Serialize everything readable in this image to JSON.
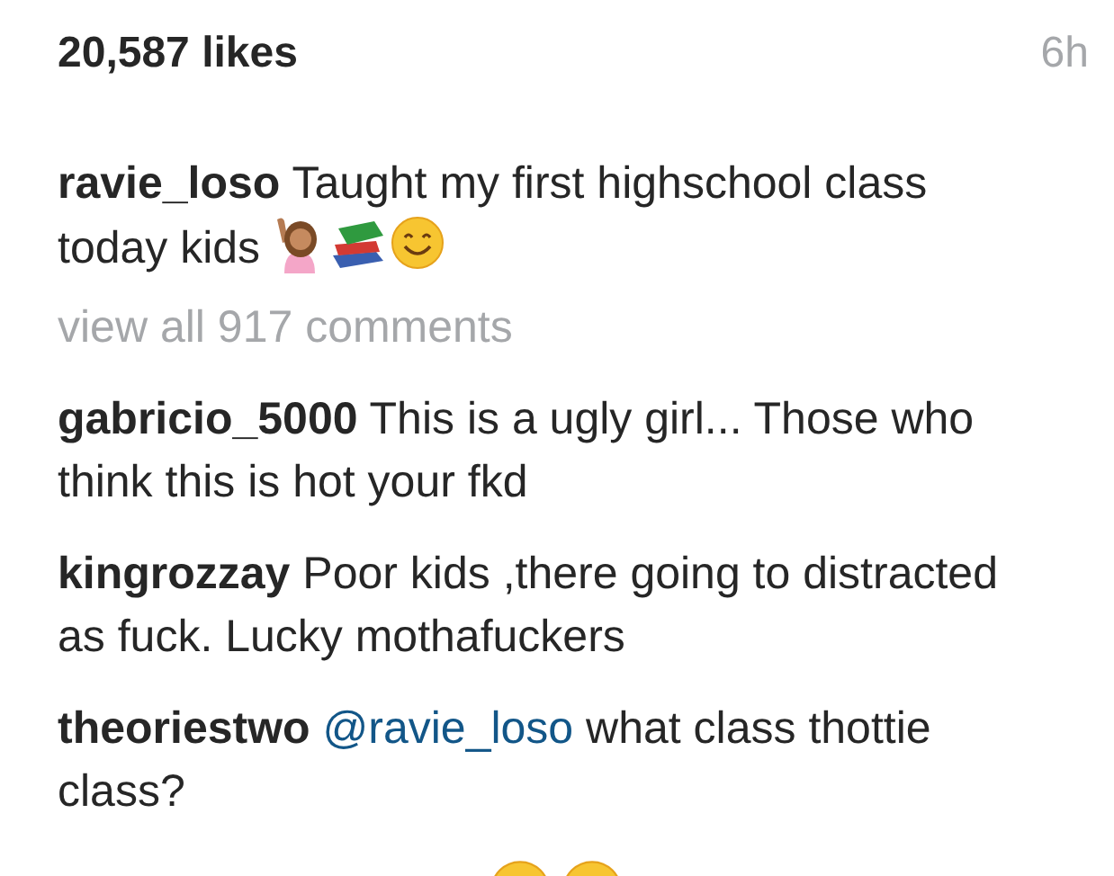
{
  "post": {
    "likes": "20,587 likes",
    "time": "6h"
  },
  "caption": {
    "username": "ravie_loso",
    "text": "Taught my first highschool class today kids"
  },
  "view_all": "view all 917 comments",
  "comments": [
    {
      "username": "gabricio_5000",
      "text": "This is a ugly girl... Those who think this is hot your fkd"
    },
    {
      "username": "kingrozzay",
      "text": "Poor kids ,there going to distracted as fuck. Lucky mothafuckers"
    },
    {
      "username": "theoriestwo",
      "mention": "@ravie_loso",
      "text": "what class thottie class?"
    }
  ]
}
